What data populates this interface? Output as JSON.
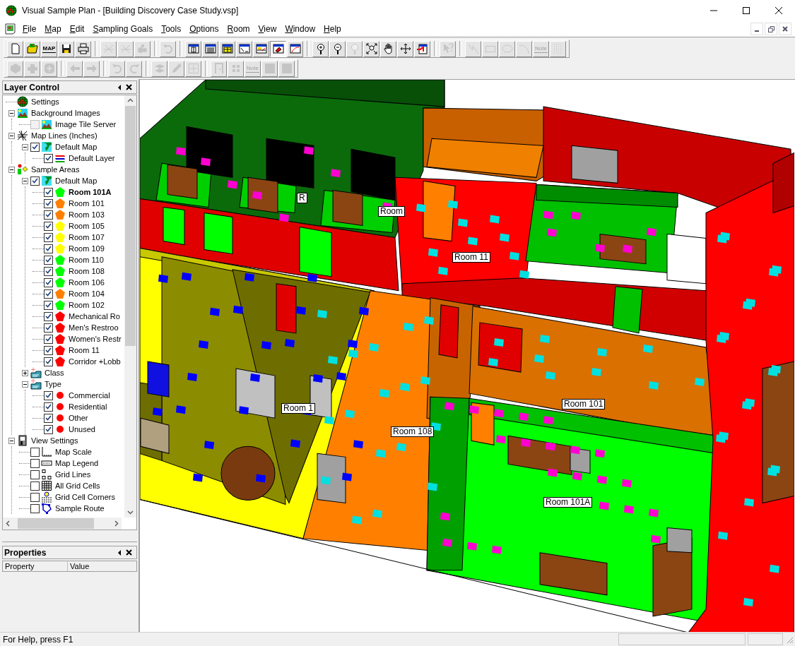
{
  "window": {
    "title": "Visual Sample Plan - [Building Discovery Case Study.vsp]"
  },
  "menu": [
    "File",
    "Map",
    "Edit",
    "Sampling Goals",
    "Tools",
    "Options",
    "Room",
    "View",
    "Window",
    "Help"
  ],
  "toolbars": [
    {
      "groups": [
        [
          {
            "disabled": false,
            "pressed": false
          },
          {
            "disabled": false,
            "pressed": false
          },
          {
            "disabled": false,
            "pressed": false,
            "label": "MAP"
          },
          {
            "disabled": false,
            "pressed": false
          },
          {
            "disabled": false,
            "pressed": false
          }
        ],
        [
          {
            "disabled": true,
            "pressed": false
          },
          {
            "disabled": true,
            "pressed": false
          },
          {
            "disabled": true,
            "pressed": false
          }
        ],
        [
          {
            "disabled": true,
            "pressed": false
          }
        ],
        [
          {
            "disabled": false,
            "pressed": false
          },
          {
            "disabled": false,
            "pressed": false
          },
          {
            "disabled": false,
            "pressed": false
          },
          {
            "disabled": false,
            "pressed": false
          },
          {
            "disabled": false,
            "pressed": false
          },
          {
            "disabled": false,
            "pressed": true
          },
          {
            "disabled": false,
            "pressed": false
          }
        ],
        [
          {
            "disabled": false,
            "pressed": false
          },
          {
            "disabled": false,
            "pressed": false
          },
          {
            "disabled": true,
            "pressed": false
          },
          {
            "disabled": false,
            "pressed": false
          },
          {
            "disabled": false,
            "pressed": false
          },
          {
            "disabled": false,
            "pressed": false
          },
          {
            "disabled": false,
            "pressed": false
          }
        ],
        [
          {
            "disabled": true,
            "pressed": false
          }
        ],
        [
          {
            "disabled": true,
            "pressed": false
          },
          {
            "disabled": true,
            "pressed": false
          },
          {
            "disabled": true,
            "pressed": false
          },
          {
            "disabled": true,
            "pressed": false
          },
          {
            "disabled": true,
            "pressed": false,
            "label": "Note"
          },
          {
            "disabled": true,
            "pressed": false
          }
        ]
      ]
    },
    {
      "groups": [
        [
          {
            "disabled": true,
            "pressed": false
          },
          {
            "disabled": true,
            "pressed": false
          },
          {
            "disabled": true,
            "pressed": false
          }
        ],
        [
          {
            "disabled": true,
            "pressed": false
          },
          {
            "disabled": true,
            "pressed": false
          }
        ],
        [
          {
            "disabled": true,
            "pressed": false
          },
          {
            "disabled": true,
            "pressed": false
          }
        ],
        [
          {
            "disabled": true,
            "pressed": false
          },
          {
            "disabled": true,
            "pressed": false
          },
          {
            "disabled": true,
            "pressed": false
          }
        ],
        [
          {
            "disabled": true,
            "pressed": false
          },
          {
            "disabled": true,
            "pressed": false
          },
          {
            "disabled": true,
            "pressed": false,
            "label": "Note"
          },
          {
            "disabled": true,
            "pressed": false
          },
          {
            "disabled": true,
            "pressed": false
          }
        ]
      ]
    }
  ],
  "layer_control": {
    "title": "Layer Control",
    "tree": [
      {
        "label": "Settings",
        "kind": "settings"
      },
      {
        "label": "Background Images",
        "kind": "images",
        "expanded": true,
        "children": [
          {
            "label": "Image Tile Server",
            "kind": "image",
            "checked": false,
            "disabled": true
          }
        ]
      },
      {
        "label": "Map Lines (Inches)",
        "kind": "lines",
        "expanded": true,
        "children": [
          {
            "label": "Default Map",
            "kind": "map",
            "checked": true,
            "expanded": true,
            "children": [
              {
                "label": "Default Layer",
                "kind": "layer",
                "checked": true
              }
            ]
          }
        ]
      },
      {
        "label": "Sample Areas",
        "kind": "areas",
        "expanded": true,
        "children": [
          {
            "label": "Default Map",
            "kind": "map",
            "checked": true,
            "expanded": true,
            "children": [
              {
                "label": "Room 101A",
                "kind": "area",
                "checked": true,
                "selected": true,
                "color": "#00ff00"
              },
              {
                "label": "Room 101",
                "kind": "area",
                "checked": true,
                "selected": false,
                "color": "#ff8000"
              },
              {
                "label": "Room 103",
                "kind": "area",
                "checked": true,
                "selected": false,
                "color": "#ff8000"
              },
              {
                "label": "Room 105",
                "kind": "area",
                "checked": true,
                "selected": false,
                "color": "#ffff00"
              },
              {
                "label": "Room 107",
                "kind": "area",
                "checked": true,
                "selected": false,
                "color": "#ffff00"
              },
              {
                "label": "Room 109",
                "kind": "area",
                "checked": true,
                "selected": false,
                "color": "#ffff00"
              },
              {
                "label": "Room 110",
                "kind": "area",
                "checked": true,
                "selected": false,
                "color": "#00ff00"
              },
              {
                "label": "Room 108",
                "kind": "area",
                "checked": true,
                "selected": false,
                "color": "#00ff00"
              },
              {
                "label": "Room 106",
                "kind": "area",
                "checked": true,
                "selected": false,
                "color": "#00ff00"
              },
              {
                "label": "Room 104",
                "kind": "area",
                "checked": true,
                "selected": false,
                "color": "#ff8000"
              },
              {
                "label": "Room 102",
                "kind": "area",
                "checked": true,
                "selected": false,
                "color": "#00ff00"
              },
              {
                "label": "Mechanical Ro",
                "kind": "area",
                "checked": true,
                "selected": false,
                "color": "#ff0000"
              },
              {
                "label": "Men's Restroo",
                "kind": "area",
                "checked": true,
                "selected": false,
                "color": "#ff0000"
              },
              {
                "label": "Women's Restr",
                "kind": "area",
                "checked": true,
                "selected": false,
                "color": "#ff0000"
              },
              {
                "label": "Room 11",
                "kind": "area",
                "checked": true,
                "selected": false,
                "color": "#ff0000"
              },
              {
                "label": "Corridor +Lobb",
                "kind": "area",
                "checked": true,
                "selected": false,
                "color": "#ff0000"
              }
            ]
          },
          {
            "label": "Class",
            "kind": "category",
            "expanded": false
          },
          {
            "label": "Type",
            "kind": "category",
            "expanded": true,
            "children": [
              {
                "label": "Commercial",
                "kind": "type",
                "checked": true,
                "color": "#ff0000"
              },
              {
                "label": "Residential",
                "kind": "type",
                "checked": true,
                "color": "#ff0000"
              },
              {
                "label": "Other",
                "kind": "type",
                "checked": true,
                "color": "#ff0000"
              },
              {
                "label": "Unused",
                "kind": "type",
                "checked": true,
                "color": "#ff0000"
              }
            ]
          }
        ]
      },
      {
        "label": "View Settings",
        "kind": "view",
        "expanded": true,
        "children": [
          {
            "label": "Map Scale",
            "kind": "option",
            "checked": false
          },
          {
            "label": "Map Legend",
            "kind": "option",
            "checked": false
          },
          {
            "label": "Grid Lines",
            "kind": "option",
            "checked": false
          },
          {
            "label": "All Grid Cells",
            "kind": "option",
            "checked": false
          },
          {
            "label": "Grid Cell Corners",
            "kind": "option",
            "checked": false
          },
          {
            "label": "Sample Route",
            "kind": "option",
            "checked": false
          }
        ]
      }
    ]
  },
  "properties": {
    "title": "Properties",
    "columns": [
      "Property",
      "Value"
    ]
  },
  "view": {
    "room_labels": [
      "R",
      "Room",
      "Room 11",
      "Room 1",
      "Room 108",
      "Room 101",
      "Room 101A"
    ]
  },
  "status_bar": {
    "text": "For Help, press F1"
  }
}
